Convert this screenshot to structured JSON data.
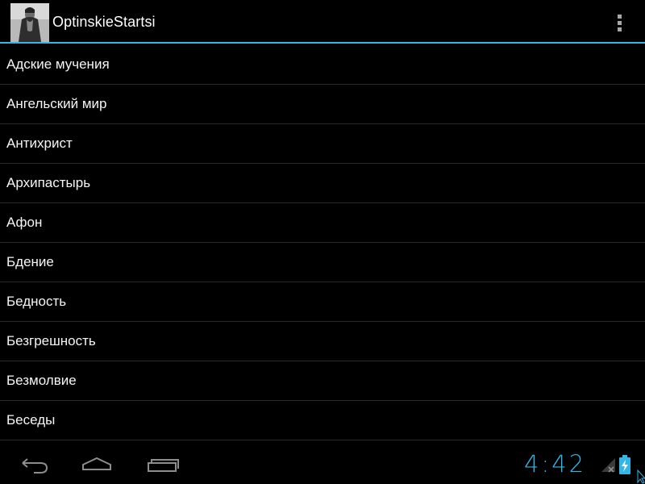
{
  "action_bar": {
    "title": "OptinskieStartsi",
    "app_icon": "elder-portrait-icon",
    "overflow_icon": "overflow-menu-icon",
    "accent_color": "#33b5e5"
  },
  "list": {
    "items": [
      {
        "label": "Адские мучения"
      },
      {
        "label": "Ангельский мир"
      },
      {
        "label": "Антихрист"
      },
      {
        "label": "Архипастырь"
      },
      {
        "label": "Афон"
      },
      {
        "label": "Бдение"
      },
      {
        "label": "Бедность"
      },
      {
        "label": "Безгрешность"
      },
      {
        "label": "Безмолвие"
      },
      {
        "label": "Беседы"
      }
    ]
  },
  "nav_bar": {
    "back_icon": "back-icon",
    "home_icon": "home-icon",
    "recents_icon": "recent-apps-icon"
  },
  "status": {
    "time": "4:42",
    "signal_icon": "signal-icon",
    "battery_icon": "battery-charging-icon",
    "clock_color": "#33b5e5"
  }
}
